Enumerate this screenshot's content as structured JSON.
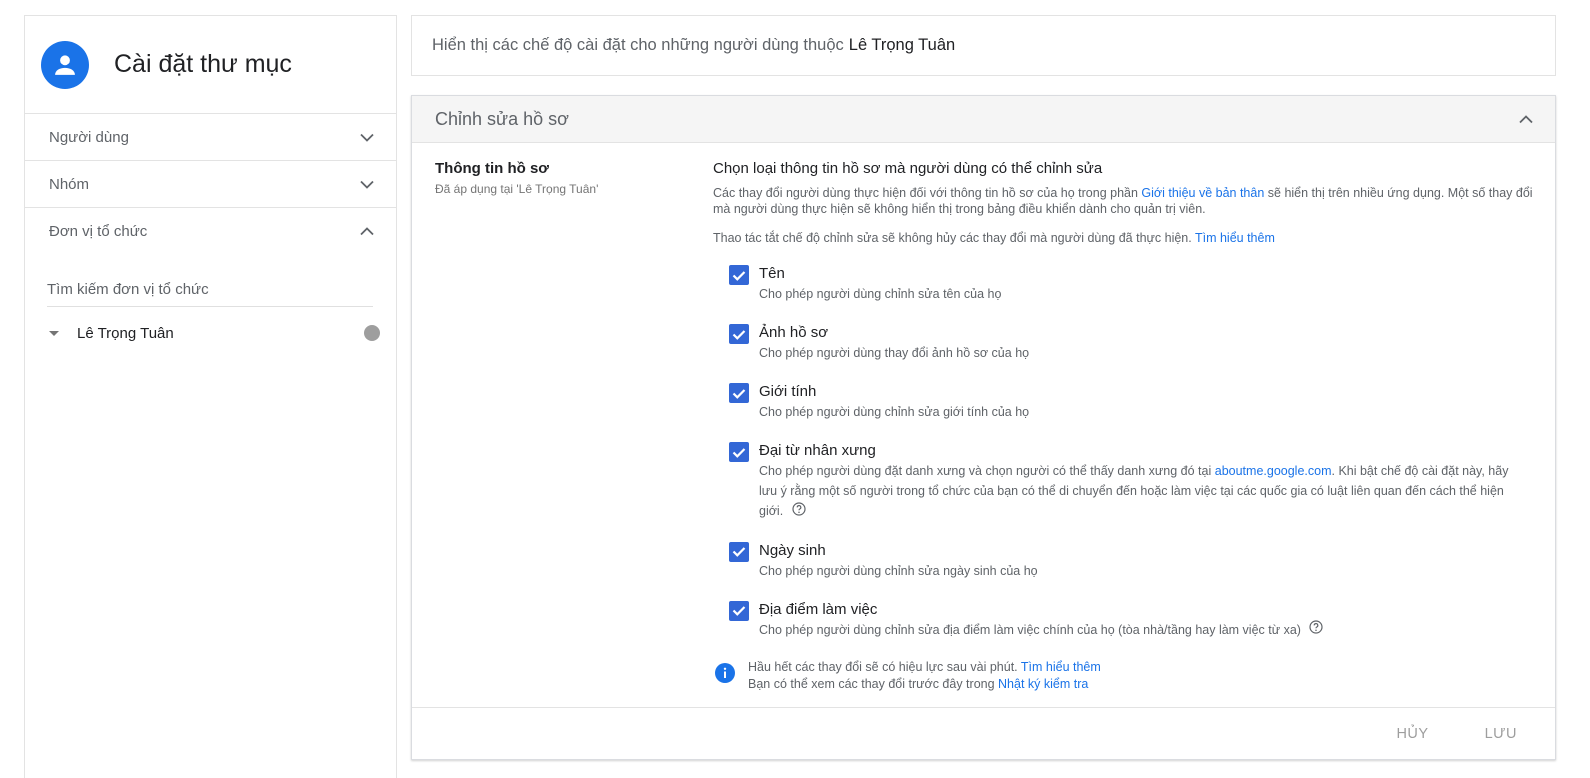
{
  "sidebar": {
    "title": "Cài đặt thư mục",
    "items": [
      {
        "label": "Người dùng"
      },
      {
        "label": "Nhóm"
      },
      {
        "label": "Đơn vị tổ chức"
      }
    ],
    "search_placeholder": "Tìm kiếm đơn vị tổ chức",
    "org_unit": "Lê Trọng Tuân"
  },
  "banner": {
    "prefix": "Hiển thị các chế độ cài đặt cho những người dùng thuộc",
    "org_name": "Lê Trọng Tuân"
  },
  "card": {
    "title": "Chỉnh sửa hồ sơ",
    "section_title": "Thông tin hồ sơ",
    "section_subtitle": "Đã áp dụng tại 'Lê Trọng Tuân'",
    "heading": "Chọn loại thông tin hồ sơ mà người dùng có thể chỉnh sửa",
    "desc_part1": "Các thay đổi người dùng thực hiện đối với thông tin hồ sơ của họ trong phần",
    "desc_link": "Giới thiệu về bản thân",
    "desc_part2": "sẽ hiển thị trên nhiều ứng dụng. Một số thay đổi mà người dùng thực hiện sẽ không hiển thị trong bảng điều khiển dành cho quản trị viên.",
    "desc2_text": "Thao tác tắt chế độ chỉnh sửa sẽ không hủy các thay đổi mà người dùng đã thực hiện.",
    "desc2_link": "Tìm hiểu thêm",
    "options": [
      {
        "label": "Tên",
        "desc": "Cho phép người dùng chỉnh sửa tên của họ",
        "checked": true
      },
      {
        "label": "Ảnh hồ sơ",
        "desc": "Cho phép người dùng thay đổi ảnh hồ sơ của họ",
        "checked": true
      },
      {
        "label": "Giới tính",
        "desc": "Cho phép người dùng chỉnh sửa giới tính của họ",
        "checked": true
      },
      {
        "label": "Đại từ nhân xưng",
        "desc_part1": "Cho phép người dùng đặt danh xưng và chọn người có thể thấy danh xưng đó tại",
        "desc_link": "aboutme.google.com",
        "desc_part2": ". Khi bật chế độ cài đặt này, hãy lưu ý rằng một số người trong tổ chức của bạn có thể di chuyển đến hoặc làm việc tại các quốc gia có luật liên quan đến cách thể hiện giới.",
        "checked": true
      },
      {
        "label": "Ngày sinh",
        "desc": "Cho phép người dùng chỉnh sửa ngày sinh của họ",
        "checked": true
      },
      {
        "label": "Địa điểm làm việc",
        "desc": "Cho phép người dùng chỉnh sửa địa điểm làm việc chính của họ (tòa nhà/tầng hay làm việc từ xa)",
        "checked": true
      }
    ],
    "info_line1": "Hầu hết các thay đổi sẽ có hiệu lực sau vài phút.",
    "info_link1": "Tìm hiểu thêm",
    "info_line2": "Bạn có thể xem các thay đổi trước đây trong",
    "info_link2": "Nhật ký kiểm tra",
    "cancel_label": "HỦY",
    "save_label": "LƯU"
  },
  "colors": {
    "accent": "#1a73e8",
    "checkbox": "#3367d6",
    "muted_text": "#5f6368"
  }
}
